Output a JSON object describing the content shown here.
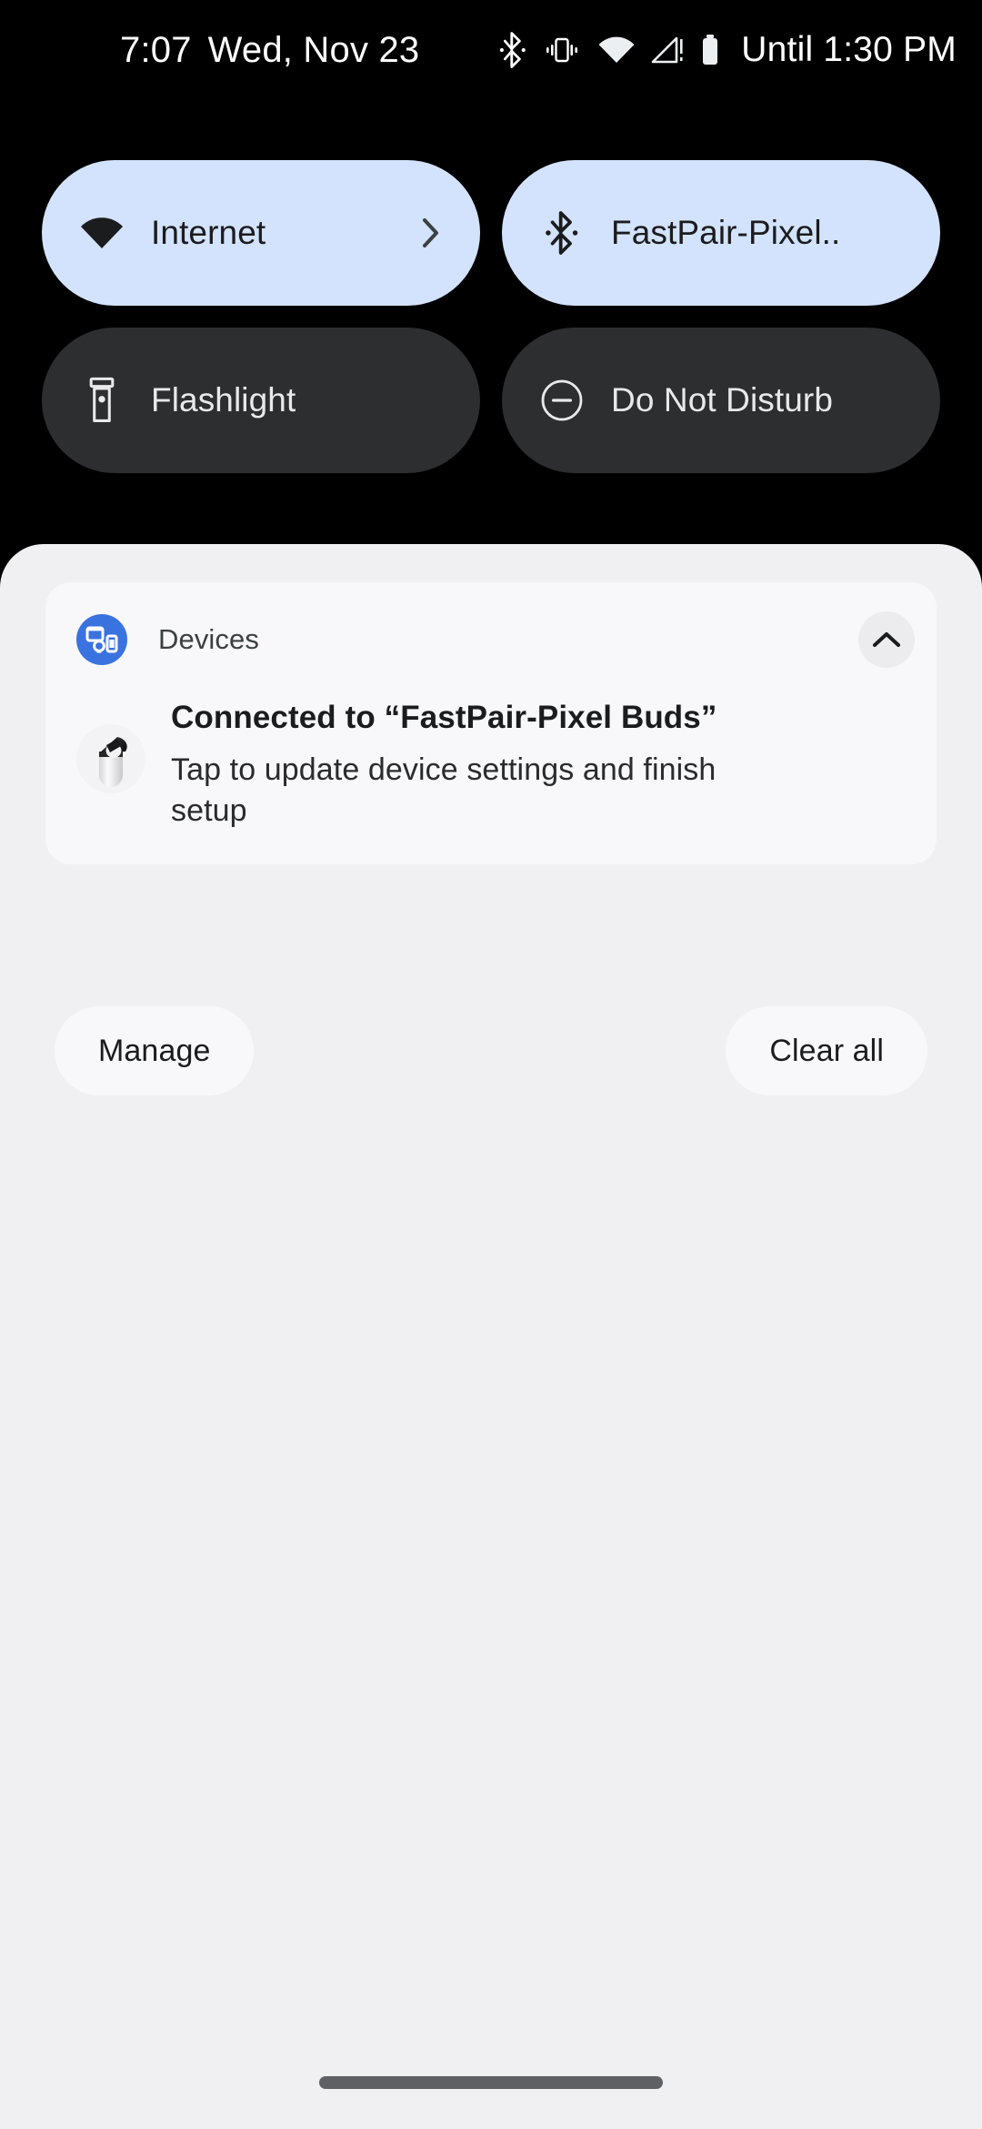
{
  "status_bar": {
    "clock": "7:07",
    "date": "Wed, Nov 23",
    "icons": [
      "bluetooth-icon",
      "vibrate-icon",
      "wifi-icon",
      "signal-no-service-icon",
      "battery-icon"
    ],
    "battery_saver_text": "Until 1:30 PM"
  },
  "quick_settings": {
    "tiles": [
      {
        "label": "Internet",
        "icon": "wifi-icon",
        "state": "on",
        "has_chevron": true
      },
      {
        "label": "FastPair-Pixel..",
        "icon": "bluetooth-icon",
        "state": "on",
        "has_chevron": false
      },
      {
        "label": "Flashlight",
        "icon": "flashlight-icon",
        "state": "off",
        "has_chevron": false
      },
      {
        "label": "Do Not Disturb",
        "icon": "do-not-disturb-icon",
        "state": "off",
        "has_chevron": false
      }
    ],
    "colors": {
      "tile_on_bg": "#d3e3fd",
      "tile_on_fg": "#1b1c1e",
      "tile_off_bg": "#2d2e30",
      "tile_off_fg": "#e9e9ea"
    }
  },
  "shade": {
    "bg_color": "#f0f0f2",
    "notification": {
      "app_name": "Devices",
      "app_icon": "devices-icon",
      "app_icon_bg": "#3a72e0",
      "collapse_icon": "chevron-up-icon",
      "thumbnail": "pixel-buds-case-image",
      "title": "Connected to “FastPair-Pixel Buds”",
      "subtitle": "Tap to update device settings and finish setup"
    },
    "actions": {
      "manage_label": "Manage",
      "clear_all_label": "Clear all"
    }
  },
  "navigation": {
    "gesture_pill": "home-gesture-pill"
  }
}
